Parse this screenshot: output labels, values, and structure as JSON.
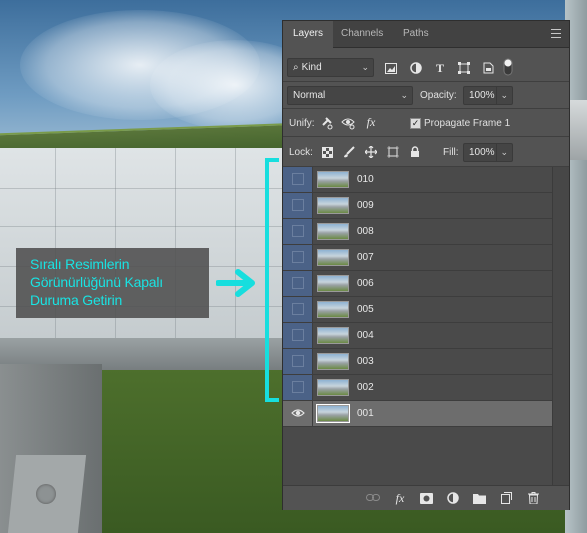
{
  "annotation": {
    "lines": [
      "Sıralı Resimlerin",
      "Görünürlüğünü Kapalı",
      "Duruma Getirin"
    ],
    "color": "#19e3e3"
  },
  "panel": {
    "tabs": [
      {
        "label": "Layers",
        "active": true
      },
      {
        "label": "Channels",
        "active": false
      },
      {
        "label": "Paths",
        "active": false
      }
    ],
    "filter": {
      "value": "Kind",
      "icons": [
        "pixel-filter-icon",
        "adjustment-filter-icon",
        "type-filter-icon",
        "shape-filter-icon",
        "smart-object-filter-icon",
        "filter-toggle-icon"
      ]
    },
    "blend_mode": "Normal",
    "opacity_label": "Opacity:",
    "opacity_value": "100%",
    "unify_label": "Unify:",
    "propagate_label": "Propagate Frame 1",
    "propagate_checked": true,
    "lock_label": "Lock:",
    "fill_label": "Fill:",
    "fill_value": "100%",
    "layers": [
      {
        "name": "010",
        "visible": false,
        "selected": false
      },
      {
        "name": "009",
        "visible": false,
        "selected": false
      },
      {
        "name": "008",
        "visible": false,
        "selected": false
      },
      {
        "name": "007",
        "visible": false,
        "selected": false
      },
      {
        "name": "006",
        "visible": false,
        "selected": false
      },
      {
        "name": "005",
        "visible": false,
        "selected": false
      },
      {
        "name": "004",
        "visible": false,
        "selected": false
      },
      {
        "name": "003",
        "visible": false,
        "selected": false
      },
      {
        "name": "002",
        "visible": false,
        "selected": false
      },
      {
        "name": "001",
        "visible": true,
        "selected": true
      }
    ],
    "hidden_eye_color": "#4b6287",
    "bottom_icons": [
      "link-layers-icon",
      "fx-icon",
      "add-mask-icon",
      "adjustment-layer-icon",
      "new-group-icon",
      "new-layer-icon",
      "delete-layer-icon"
    ]
  }
}
